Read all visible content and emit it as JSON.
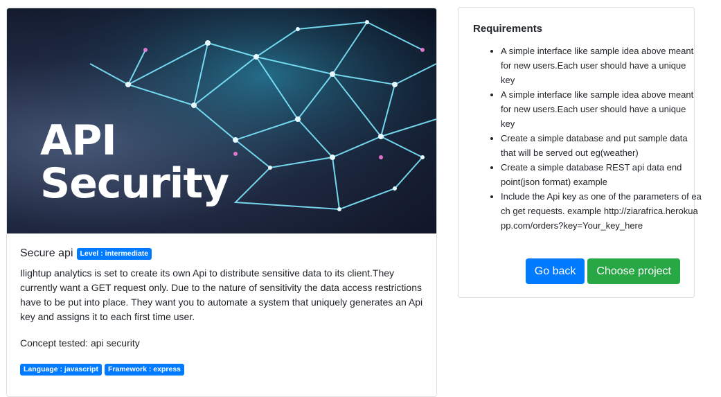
{
  "hero": {
    "title_line1": "API",
    "title_line2": "Security"
  },
  "project": {
    "title": "Secure api",
    "level_badge": "Level : intermediate",
    "description": "Ilightup analytics is set to create its own Api to distribute sensitive data to its client.They currently want a GET request only. Due to the nature of sensitivity the data access restrictions have to be put into place. They want you to automate a system that uniquely generates an Api key and assigns it to each first time user.",
    "concept": "Concept tested: api security",
    "tags": [
      "Language : javascript",
      "Framework : express"
    ]
  },
  "requirements": {
    "title": "Requirements",
    "items": [
      "A simple interface like sample idea above meant for new users.Each user should have a unique key",
      "A simple interface like sample idea above meant for new users.Each user should have a unique key",
      "Create a simple database and put sample data that will be served out eg(weather)",
      "Create a simple database REST api data end point(json format) example",
      "Include the Api key as one of the parameters of each get requests. example http://ziarafrica.herokuapp.com/orders?key=Your_key_here"
    ]
  },
  "actions": {
    "go_back": "Go back",
    "choose_project": "Choose project"
  },
  "colors": {
    "primary": "#007bff",
    "success": "#28a745"
  }
}
